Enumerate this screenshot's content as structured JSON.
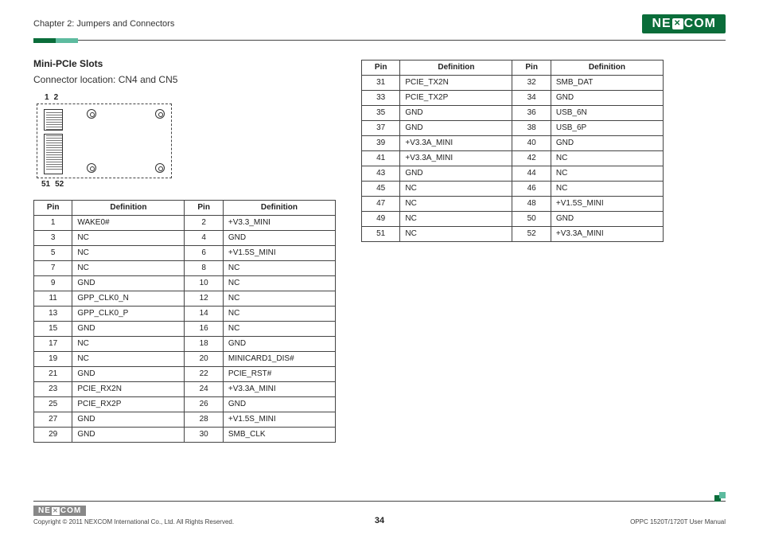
{
  "header": {
    "chapter": "Chapter 2: Jumpers and Connectors",
    "logo_l": "NE",
    "logo_r": "COM"
  },
  "section": {
    "title": "Mini-PCIe Slots",
    "connector_location": "Connector location: CN4 and CN5",
    "pin_tl": "1",
    "pin_tr": "2",
    "pin_bl": "51",
    "pin_br": "52"
  },
  "table_headers": {
    "pin": "Pin",
    "definition": "Definition"
  },
  "table_left": [
    {
      "p1": "1",
      "d1": "WAKE0#",
      "p2": "2",
      "d2": "+V3.3_MINI"
    },
    {
      "p1": "3",
      "d1": "NC",
      "p2": "4",
      "d2": "GND"
    },
    {
      "p1": "5",
      "d1": "NC",
      "p2": "6",
      "d2": "+V1.5S_MINI"
    },
    {
      "p1": "7",
      "d1": "NC",
      "p2": "8",
      "d2": "NC"
    },
    {
      "p1": "9",
      "d1": "GND",
      "p2": "10",
      "d2": "NC"
    },
    {
      "p1": "11",
      "d1": "GPP_CLK0_N",
      "p2": "12",
      "d2": "NC"
    },
    {
      "p1": "13",
      "d1": "GPP_CLK0_P",
      "p2": "14",
      "d2": "NC"
    },
    {
      "p1": "15",
      "d1": "GND",
      "p2": "16",
      "d2": "NC"
    },
    {
      "p1": "17",
      "d1": "NC",
      "p2": "18",
      "d2": "GND"
    },
    {
      "p1": "19",
      "d1": "NC",
      "p2": "20",
      "d2": "MINICARD1_DIS#"
    },
    {
      "p1": "21",
      "d1": "GND",
      "p2": "22",
      "d2": "PCIE_RST#"
    },
    {
      "p1": "23",
      "d1": "PCIE_RX2N",
      "p2": "24",
      "d2": "+V3.3A_MINI"
    },
    {
      "p1": "25",
      "d1": "PCIE_RX2P",
      "p2": "26",
      "d2": "GND"
    },
    {
      "p1": "27",
      "d1": "GND",
      "p2": "28",
      "d2": "+V1.5S_MINI"
    },
    {
      "p1": "29",
      "d1": "GND",
      "p2": "30",
      "d2": "SMB_CLK"
    }
  ],
  "table_right": [
    {
      "p1": "31",
      "d1": "PCIE_TX2N",
      "p2": "32",
      "d2": "SMB_DAT"
    },
    {
      "p1": "33",
      "d1": "PCIE_TX2P",
      "p2": "34",
      "d2": "GND"
    },
    {
      "p1": "35",
      "d1": "GND",
      "p2": "36",
      "d2": "USB_6N"
    },
    {
      "p1": "37",
      "d1": "GND",
      "p2": "38",
      "d2": "USB_6P"
    },
    {
      "p1": "39",
      "d1": "+V3.3A_MINI",
      "p2": "40",
      "d2": "GND"
    },
    {
      "p1": "41",
      "d1": "+V3.3A_MINI",
      "p2": "42",
      "d2": "NC"
    },
    {
      "p1": "43",
      "d1": "GND",
      "p2": "44",
      "d2": "NC"
    },
    {
      "p1": "45",
      "d1": "NC",
      "p2": "46",
      "d2": "NC"
    },
    {
      "p1": "47",
      "d1": "NC",
      "p2": "48",
      "d2": "+V1.5S_MINI"
    },
    {
      "p1": "49",
      "d1": "NC",
      "p2": "50",
      "d2": "GND"
    },
    {
      "p1": "51",
      "d1": "NC",
      "p2": "52",
      "d2": "+V3.3A_MINI"
    }
  ],
  "footer": {
    "logo_l": "NE",
    "logo_r": "COM",
    "copyright": "Copyright © 2011 NEXCOM International Co., Ltd. All Rights Reserved.",
    "page": "34",
    "manual": "OPPC 1520T/1720T User Manual"
  }
}
